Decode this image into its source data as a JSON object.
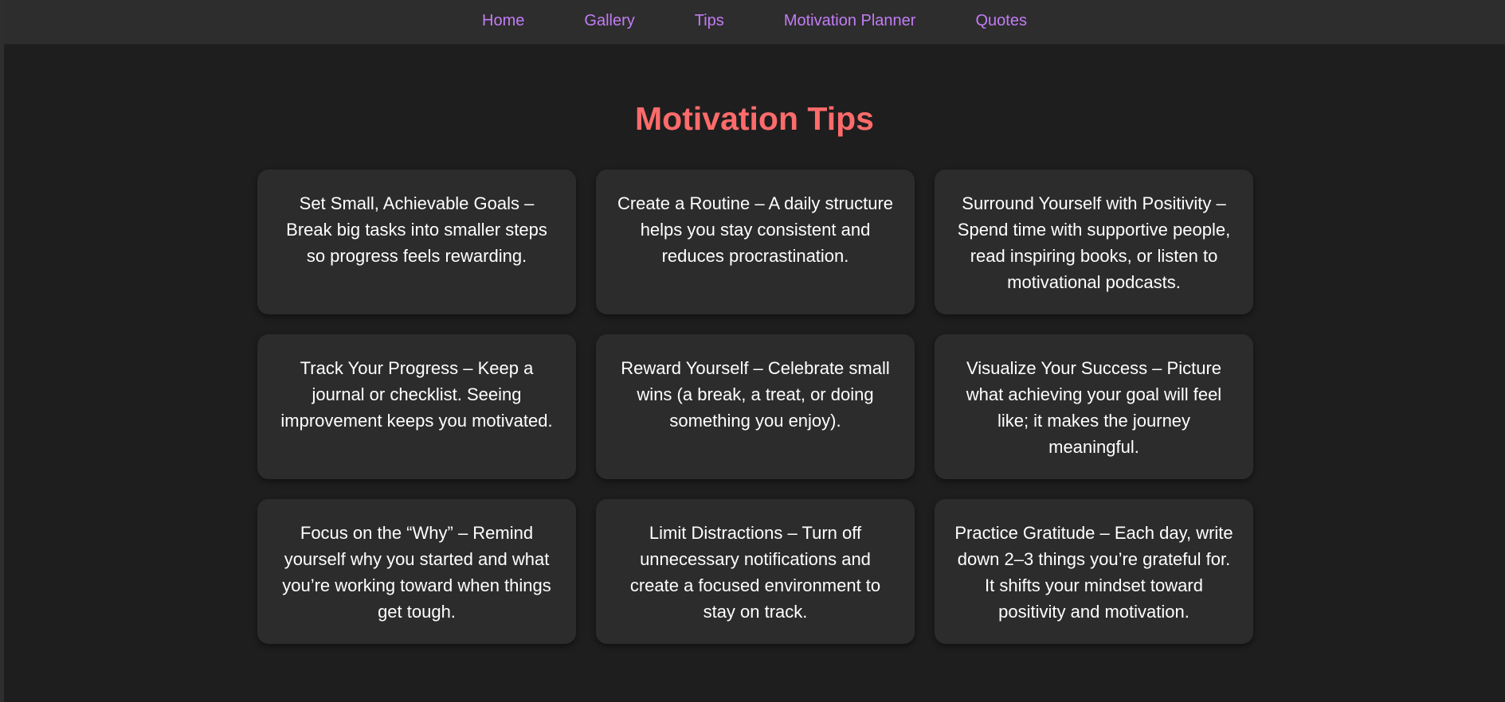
{
  "nav": {
    "items": [
      {
        "label": "Home"
      },
      {
        "label": "Gallery"
      },
      {
        "label": "Tips"
      },
      {
        "label": "Motivation Planner"
      },
      {
        "label": "Quotes"
      }
    ]
  },
  "main": {
    "title": "Motivation Tips",
    "tips": [
      {
        "text": "Set Small, Achievable Goals – Break big tasks into smaller steps so progress feels rewarding."
      },
      {
        "text": "Create a Routine – A daily structure helps you stay consistent and reduces procrastination."
      },
      {
        "text": "Surround Yourself with Positivity – Spend time with supportive people, read inspiring books, or listen to motivational podcasts."
      },
      {
        "text": "Track Your Progress – Keep a journal or checklist. Seeing improvement keeps you motivated."
      },
      {
        "text": "Reward Yourself – Celebrate small wins (a break, a treat, or doing something you enjoy)."
      },
      {
        "text": "Visualize Your Success – Picture what achieving your goal will feel like; it makes the journey meaningful."
      },
      {
        "text": "Focus on the “Why” – Remind yourself why you started and what you’re working toward when things get tough."
      },
      {
        "text": "Limit Distractions – Turn off unnecessary notifications and create a focused environment to stay on track."
      },
      {
        "text": "Practice Gratitude – Each day, write down 2–3 things you’re grateful for. It shifts your mindset toward positivity and motivation."
      }
    ]
  },
  "colors": {
    "background": "#1e1e1e",
    "nav_background": "#2d2d2d",
    "nav_link": "#c27cf5",
    "title": "#ff6b6b",
    "card_background": "#2c2c2c",
    "card_text": "#ffffff"
  }
}
